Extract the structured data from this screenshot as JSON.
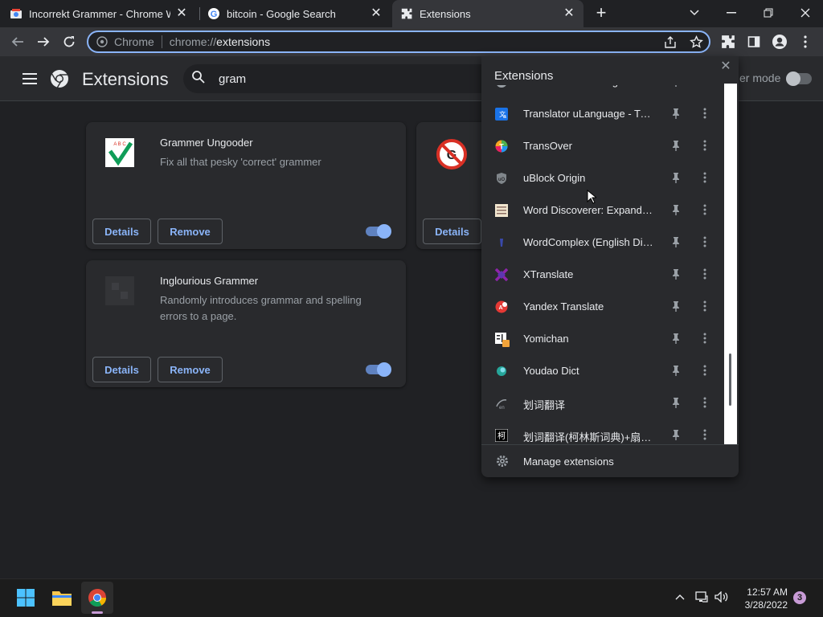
{
  "browser": {
    "tabs": [
      {
        "title": "Incorrekt Grammer - Chrome We",
        "active": false
      },
      {
        "title": "bitcoin - Google Search",
        "active": false
      },
      {
        "title": "Extensions",
        "active": true
      }
    ],
    "omnibox": {
      "site_label": "Chrome",
      "url_scheme": "chrome://",
      "url_path": "extensions"
    }
  },
  "page": {
    "title": "Extensions",
    "search_value": "gram",
    "dev_mode_label": "er mode",
    "dev_mode_on": false
  },
  "cards": [
    {
      "name": "Grammer Ungooder",
      "description": "Fix all that pesky 'correct' grammer",
      "details_label": "Details",
      "remove_label": "Remove",
      "enabled": true
    },
    {
      "name": "Inglourious Grammer",
      "description": "Randomly introduces grammar and spelling errors to a page.",
      "details_label": "Details",
      "remove_label": "Remove",
      "enabled": true
    },
    {
      "details_label": "Details"
    }
  ],
  "popup": {
    "title": "Extensions",
    "partial_top_item": "Translation Exchange",
    "items": [
      {
        "name": "Translator uLanguage - Tran...",
        "icon": "translator-icon"
      },
      {
        "name": "TransOver",
        "icon": "transover-icon"
      },
      {
        "name": "uBlock Origin",
        "icon": "ublock-icon"
      },
      {
        "name": "Word Discoverer: Expand yo...",
        "icon": "word-discoverer-icon"
      },
      {
        "name": "WordComplex (English Dicti...",
        "icon": "wordcomplex-icon"
      },
      {
        "name": "XTranslate",
        "icon": "xtranslate-icon"
      },
      {
        "name": "Yandex Translate",
        "icon": "yandex-icon"
      },
      {
        "name": "Yomichan",
        "icon": "yomichan-icon"
      },
      {
        "name": "Youdao Dict",
        "icon": "youdao-icon"
      },
      {
        "name": "划词翻译",
        "icon": "huaci-icon"
      },
      {
        "name": "划词翻译(柯林斯词典)+扇贝...",
        "icon": "collins-icon"
      }
    ],
    "footer_label": "Manage extensions"
  },
  "taskbar": {
    "time": "12:57 AM",
    "date": "3/28/2022",
    "notification_count": "3"
  },
  "colors": {
    "accent": "#8ab4f8",
    "background": "#202124",
    "surface": "#292a2d"
  }
}
